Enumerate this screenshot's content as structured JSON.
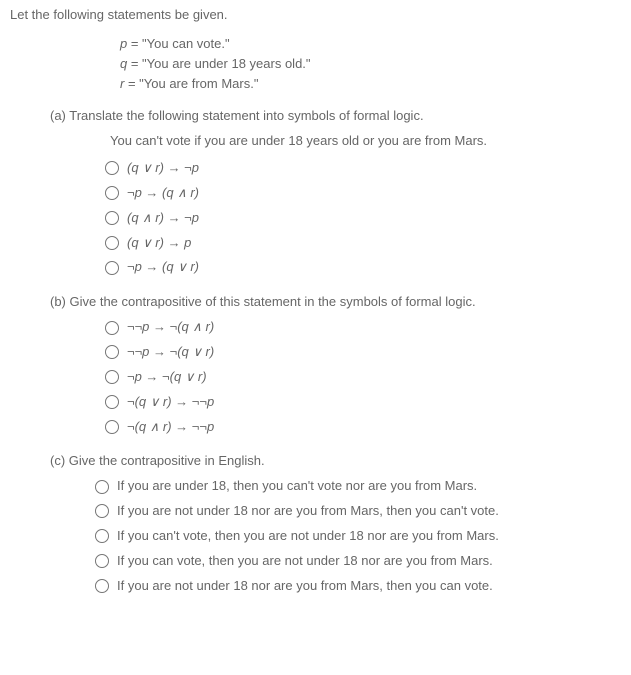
{
  "intro": "Let the following statements be given.",
  "defs": {
    "p_var": "p",
    "p_eq": " = \"You can vote.\"",
    "q_var": "q",
    "q_eq": " = \"You are under 18 years old.\"",
    "r_var": "r",
    "r_eq": " = \"You are from Mars.\""
  },
  "a": {
    "q": "(a) Translate the following statement into symbols of formal logic.",
    "stmt": "You can't vote if you are under 18 years old or you are from Mars.",
    "opts": [
      "(q ∨ r) → ¬p",
      "¬p → (q ∧ r)",
      "(q ∧ r) → ¬p",
      "(q ∨ r) → p",
      "¬p → (q ∨ r)"
    ]
  },
  "b": {
    "q": "(b) Give the contrapositive of this statement in the symbols of formal logic.",
    "opts": [
      "¬¬p → ¬(q ∧ r)",
      "¬¬p → ¬(q ∨ r)",
      "¬p → ¬(q ∨ r)",
      "¬(q ∨ r) → ¬¬p",
      "¬(q ∧ r) → ¬¬p"
    ]
  },
  "c": {
    "q": "(c) Give the contrapositive in English.",
    "opts": [
      "If you are under 18, then you can't vote nor are you from Mars.",
      "If you are not under 18 nor are you from Mars, then you can't vote.",
      "If you can't vote, then you are not under 18 nor are you from Mars.",
      "If you can vote, then you are not under 18 nor are you from Mars.",
      "If you are not under 18 nor are you from Mars, then you can vote."
    ]
  }
}
